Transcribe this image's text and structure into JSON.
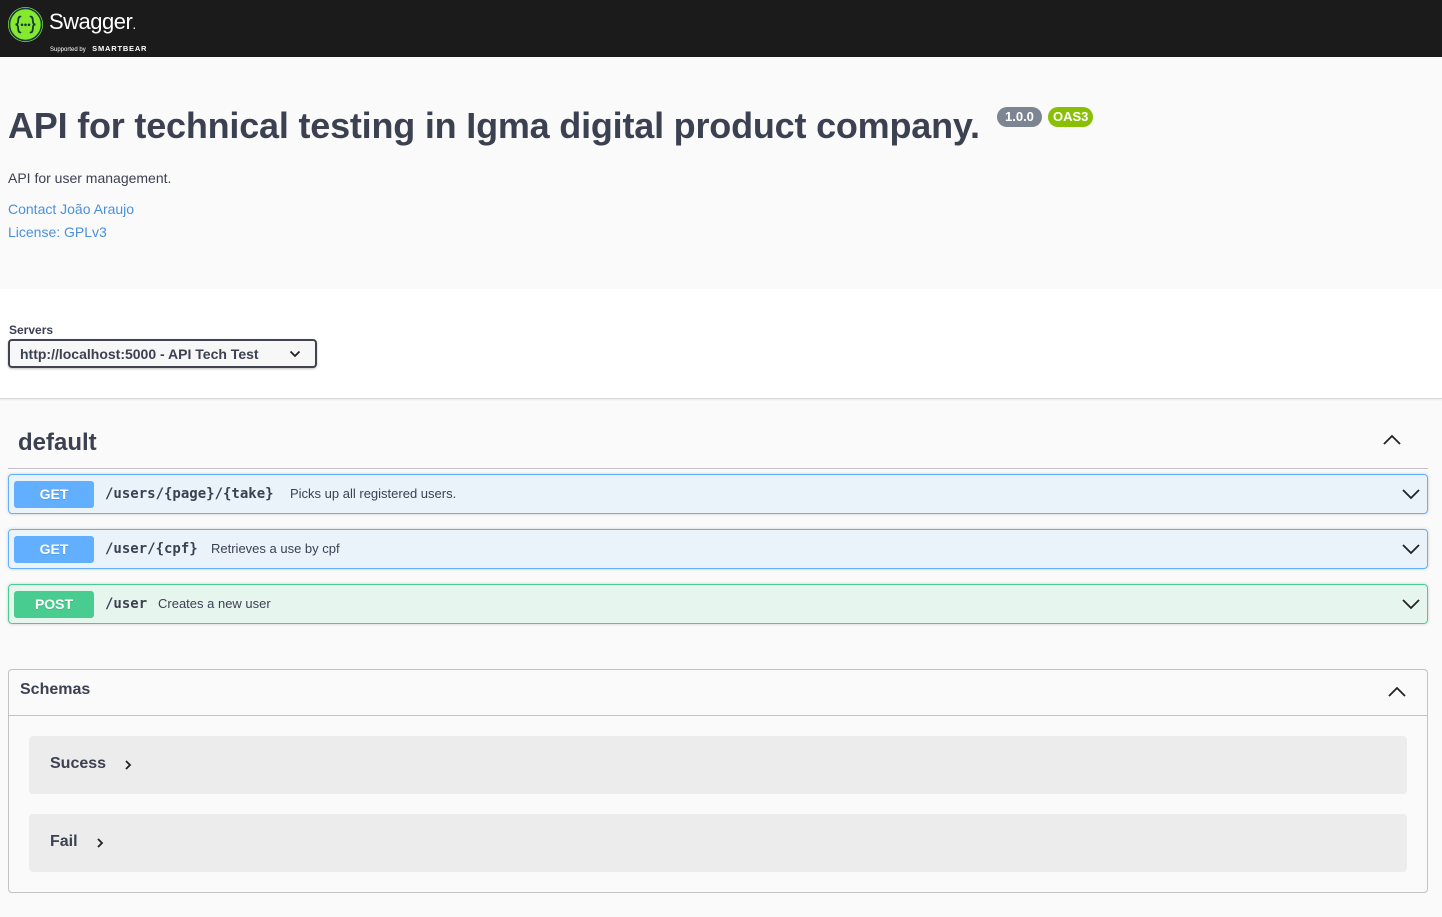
{
  "topbar": {
    "logo_icon": "swagger-braces-icon",
    "brand_name": "Swagger",
    "brand_dot": ".",
    "supported_by": "Supported by",
    "supporter": "SMARTBEAR",
    "colors": {
      "background": "#1b1b1b",
      "logo": "#85ea2d"
    }
  },
  "info": {
    "title": "API for technical testing in Igma digital product company.",
    "version": "1.0.0",
    "oas_badge": "OAS3",
    "description": "API for user management.",
    "contact": "Contact João Araujo",
    "license": "License: GPLv3"
  },
  "servers": {
    "label": "Servers",
    "selected": "http://localhost:5000 - API Tech Test"
  },
  "tag": {
    "name": "default",
    "operations": [
      {
        "method": "GET",
        "path": "/users/{page}/{take}",
        "summary": "Picks up all registered users."
      },
      {
        "method": "GET",
        "path": "/user/{cpf}",
        "summary": "Retrieves a use by cpf"
      },
      {
        "method": "POST",
        "path": "/user",
        "summary": "Creates a new user"
      }
    ]
  },
  "schemas": {
    "title": "Schemas",
    "models": [
      {
        "name": "Sucess"
      },
      {
        "name": "Fail"
      }
    ]
  },
  "colors": {
    "get": "#61affe",
    "post": "#49cc90",
    "link": "#4990e2",
    "text": "#3b4151"
  }
}
